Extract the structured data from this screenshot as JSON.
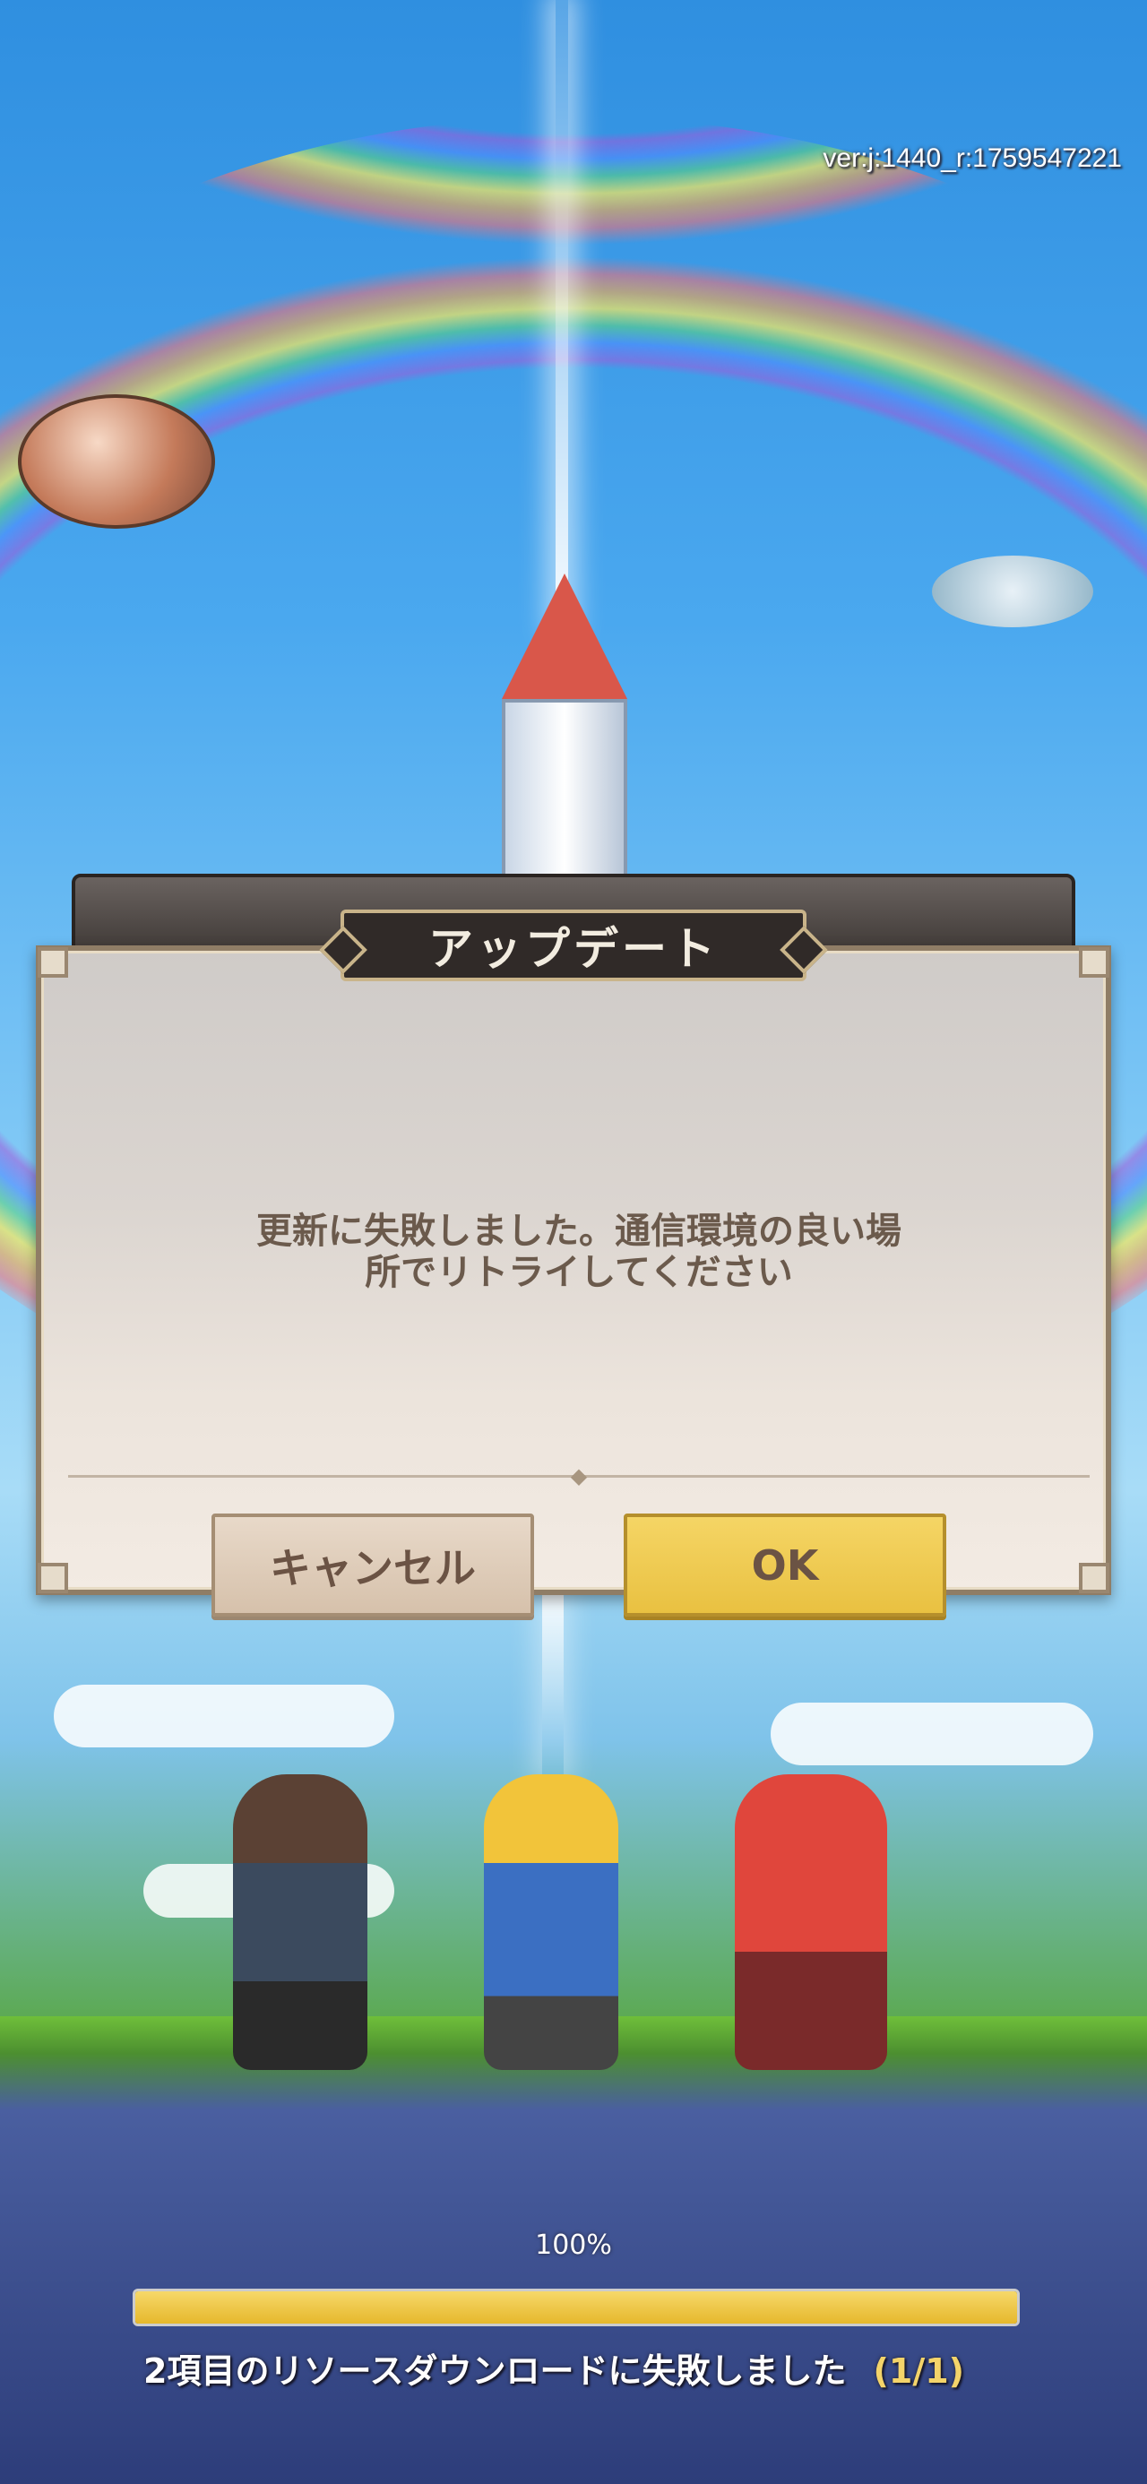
{
  "version_text": "ver:j:1440_r:1759547221",
  "dialog": {
    "title": "アップデート",
    "message_line1": "更新に失敗しました。通信環境の良い場",
    "message_line2": "所でリトライしてください",
    "cancel_label": "キャンセル",
    "ok_label": "OK"
  },
  "progress": {
    "percent_text": "100%",
    "value": 1.0,
    "status_text": "2項目のリソースダウンロードに失敗しました",
    "count_text": "(1/1)"
  },
  "colors": {
    "ok_button": "#e9c141",
    "cancel_button": "#d6c1ab",
    "progress_fill": "#e6b82c"
  }
}
